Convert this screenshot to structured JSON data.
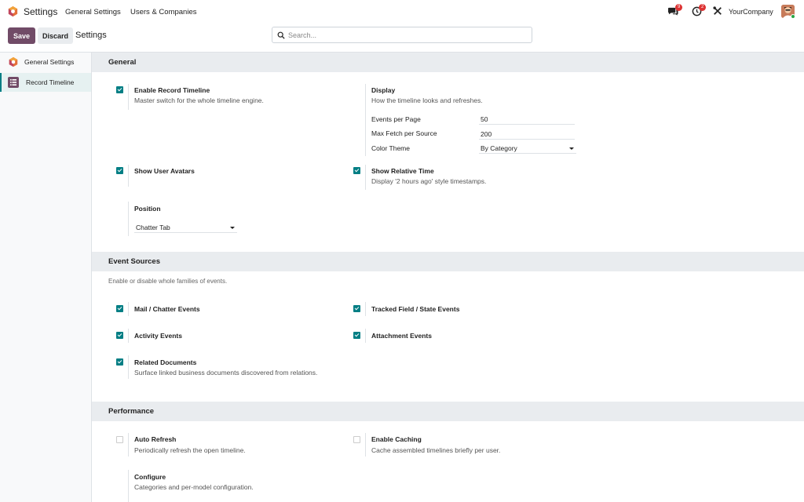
{
  "topbar": {
    "app_title": "Settings",
    "menu": [
      "General Settings",
      "Users & Companies"
    ],
    "messages_badge": "9",
    "activities_badge": "2",
    "company": "YourCompany"
  },
  "control": {
    "save_label": "Save",
    "discard_label": "Discard",
    "title": "Settings",
    "search_placeholder": "Search..."
  },
  "sidebar": {
    "items": [
      {
        "label": "General Settings"
      },
      {
        "label": "Record Timeline"
      }
    ]
  },
  "sections": {
    "general": {
      "title": "General",
      "enable_timeline": {
        "title": "Enable Record Timeline",
        "desc": "Master switch for the whole timeline engine.",
        "checked": true
      },
      "display": {
        "title": "Display",
        "desc": "How the timeline looks and refreshes.",
        "events_per_page_label": "Events per Page",
        "events_per_page": "50",
        "max_fetch_label": "Max Fetch per Source",
        "max_fetch": "200",
        "color_theme_label": "Color Theme",
        "color_theme": "By Category"
      },
      "show_avatars": {
        "title": "Show User Avatars",
        "checked": true
      },
      "relative_time": {
        "title": "Show Relative Time",
        "desc": "Display '2 hours ago' style timestamps.",
        "checked": true
      },
      "position": {
        "title": "Position",
        "value": "Chatter Tab"
      }
    },
    "event_sources": {
      "title": "Event Sources",
      "desc": "Enable or disable whole families of events.",
      "mail": {
        "title": "Mail / Chatter Events",
        "checked": true
      },
      "tracked": {
        "title": "Tracked Field / State Events",
        "checked": true
      },
      "activity": {
        "title": "Activity Events",
        "checked": true
      },
      "attachment": {
        "title": "Attachment Events",
        "checked": true
      },
      "related": {
        "title": "Related Documents",
        "desc": "Surface linked business documents discovered from relations.",
        "checked": true
      }
    },
    "performance": {
      "title": "Performance",
      "auto_refresh": {
        "title": "Auto Refresh",
        "desc": "Periodically refresh the open timeline.",
        "checked": false
      },
      "caching": {
        "title": "Enable Caching",
        "desc": "Cache assembled timelines briefly per user.",
        "checked": false
      },
      "configure": {
        "title": "Configure",
        "desc": "Categories and per-model configuration."
      }
    }
  },
  "colors": {
    "brand": "#714b67",
    "accent": "#017e84",
    "badge": "#dd3333"
  },
  "icons": [
    "odoo-logo-icon",
    "chat-icon",
    "clock-icon",
    "tools-icon",
    "search-icon",
    "list-icon"
  ]
}
